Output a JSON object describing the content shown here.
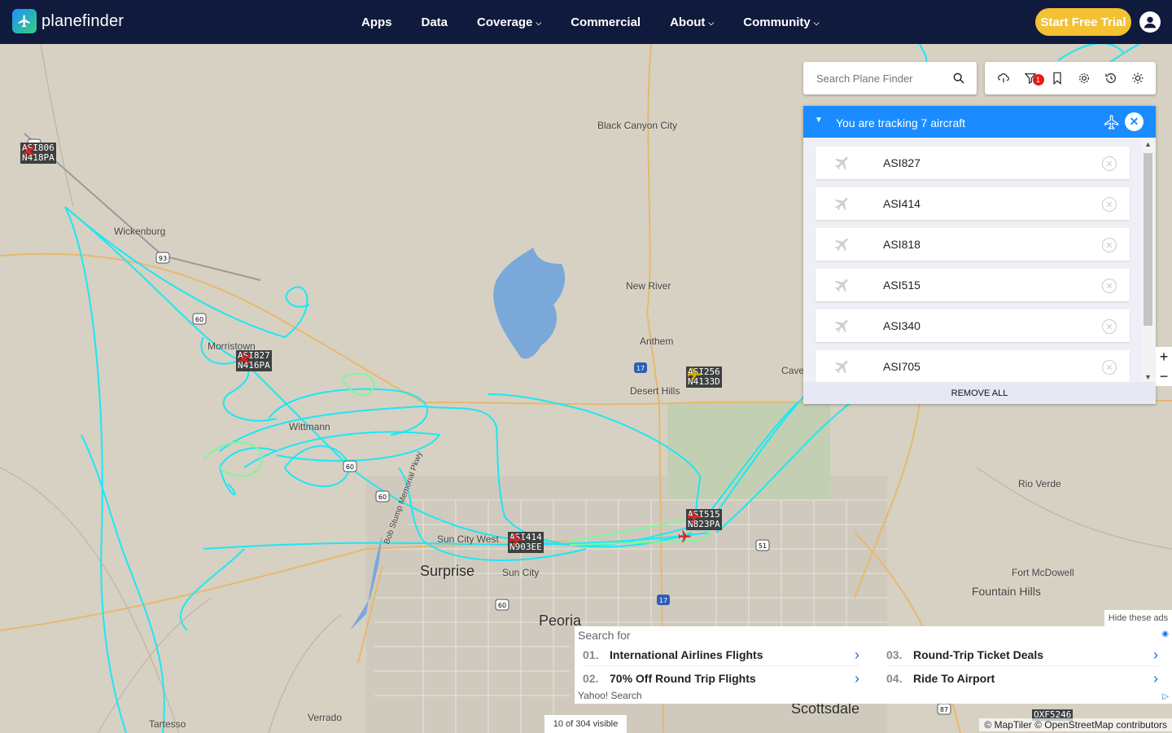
{
  "brand": {
    "name": "planefinder"
  },
  "nav": {
    "items": [
      {
        "label": "Apps",
        "dropdown": false
      },
      {
        "label": "Data",
        "dropdown": false
      },
      {
        "label": "Coverage",
        "dropdown": true
      },
      {
        "label": "Commercial",
        "dropdown": false
      },
      {
        "label": "About",
        "dropdown": true
      },
      {
        "label": "Community",
        "dropdown": true
      }
    ],
    "cta": "Start Free Trial"
  },
  "search": {
    "placeholder": "Search Plane Finder"
  },
  "toolbar": {
    "icons": [
      "weather-icon",
      "filter-icon",
      "bookmark-icon",
      "settings-icon",
      "history-icon",
      "sun-icon"
    ],
    "filter_badge": "1"
  },
  "tracking": {
    "title": "You are tracking 7 aircraft",
    "items": [
      "ASI827",
      "ASI414",
      "ASI818",
      "ASI515",
      "ASI340",
      "ASI705"
    ],
    "remove_all": "REMOVE ALL"
  },
  "map": {
    "places": [
      "Black Canyon City",
      "Wickenburg",
      "New River",
      "Anthem",
      "Desert Hills",
      "Cave",
      "Morristown",
      "Wittmann",
      "Rio Verde",
      "Surprise",
      "Sun City West",
      "Sun City",
      "Peoria",
      "Fort McDowell",
      "Fountain Hills",
      "Scottsdale",
      "Tartesso",
      "Verrado",
      "Bob Stump Memorial Pkwy"
    ],
    "aircraft": [
      {
        "callsign": "ASI806",
        "reg": "N418PA"
      },
      {
        "callsign": "ASI827",
        "reg": "N416PA"
      },
      {
        "callsign": "ASI256",
        "reg": "N4133D"
      },
      {
        "callsign": "ASI515",
        "reg": "N823PA"
      },
      {
        "callsign": "ASI414",
        "reg": "N903EE"
      },
      {
        "callsign": "OXF5246",
        "reg": ""
      }
    ],
    "road_shields": [
      "93",
      "93",
      "60",
      "60",
      "60",
      "60",
      "17",
      "17",
      "51",
      "87"
    ],
    "visible_counter": "10 of 304 visible",
    "attribution": "© MapTiler © OpenStreetMap contributors"
  },
  "ads": {
    "hide_label": "Hide these ads",
    "header": "Search for",
    "items": [
      {
        "num": "01.",
        "text": "International Airlines Flights"
      },
      {
        "num": "03.",
        "text": "Round-Trip Ticket Deals"
      },
      {
        "num": "02.",
        "text": "70% Off Round Trip Flights"
      },
      {
        "num": "04.",
        "text": "Ride To Airport"
      }
    ],
    "footer": "Yahoo! Search"
  },
  "colors": {
    "nav_bg": "#0f1a3c",
    "accent": "#1a8cff",
    "cta": "#f3c132",
    "track": "#1ee6f5",
    "track_green": "#7ef79a",
    "map_bg": "#d6d1c3"
  }
}
